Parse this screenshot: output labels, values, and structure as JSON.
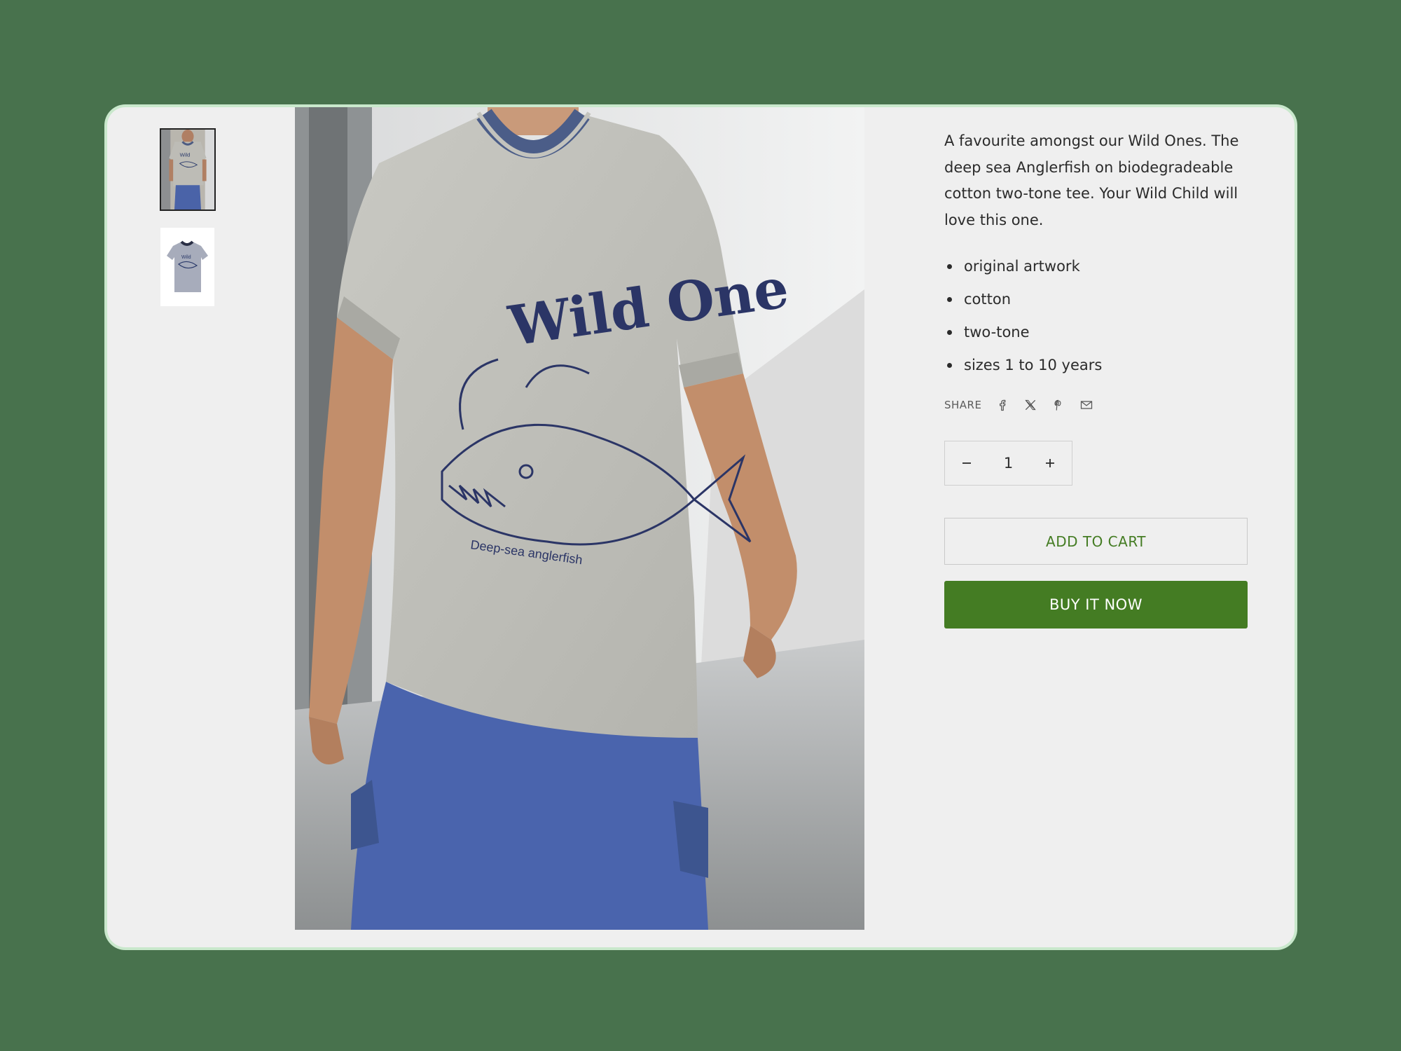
{
  "product": {
    "description": "A favourite amongst our Wild Ones. The deep sea Anglerfish on biodegradeable cotton two-tone tee. Your Wild Child will love this one.",
    "features": [
      "original artwork",
      "cotton",
      "two-tone",
      "sizes 1 to 10 years"
    ],
    "image_print_title": "Wild One",
    "image_print_caption": "Deep-sea anglerfish"
  },
  "share": {
    "label": "SHARE",
    "icons": [
      "facebook-icon",
      "x-icon",
      "pinterest-icon",
      "email-icon"
    ]
  },
  "quantity": {
    "value": "1"
  },
  "buttons": {
    "add_to_cart": "ADD TO CART",
    "buy_now": "BUY IT NOW"
  },
  "colors": {
    "background": "#48724d",
    "card": "#efefef",
    "accent": "#447c23",
    "card_outline": "#c9e8cc"
  },
  "thumbnails": {
    "selected_index": 0,
    "count": 2
  }
}
